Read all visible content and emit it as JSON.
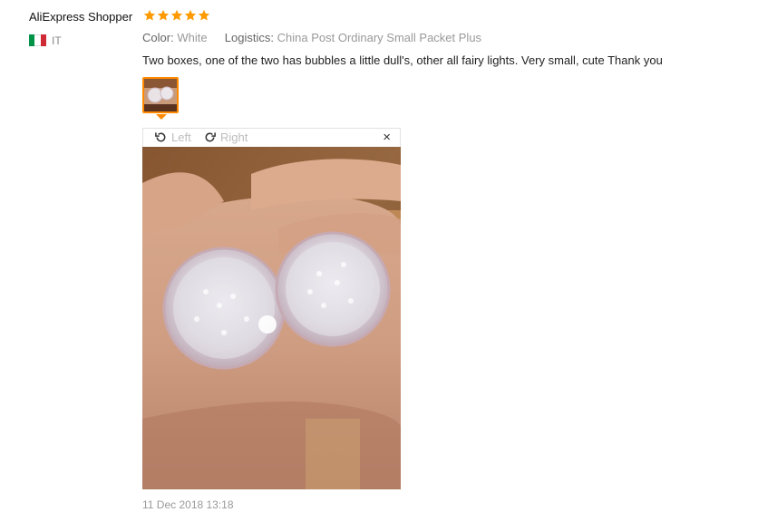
{
  "review": {
    "username": "AliExpress Shopper",
    "rating": 5,
    "country": "IT",
    "color_label": "Color:",
    "color_value": "White",
    "logistics_label": "Logistics:",
    "logistics_value": "China Post Ordinary Small Packet Plus",
    "text": "Two boxes, one of the two has bubbles a little dull's, other all fairy lights. Very small, cute Thank you",
    "date": "11 Dec 2018 13:18"
  },
  "viewer": {
    "rotate_left_label": "Left",
    "rotate_right_label": "Right",
    "close_symbol": "×"
  },
  "colors": {
    "star": "#ff9a00",
    "thumb_border": "#ff8a00",
    "flag_green": "#009246",
    "flag_white": "#ffffff",
    "flag_red": "#ce2b37"
  },
  "icons": {
    "star": "star-icon",
    "rotate_left": "rotate-left-icon",
    "rotate_right": "rotate-right-icon",
    "close": "close-icon",
    "flag": "italy-flag-icon"
  }
}
